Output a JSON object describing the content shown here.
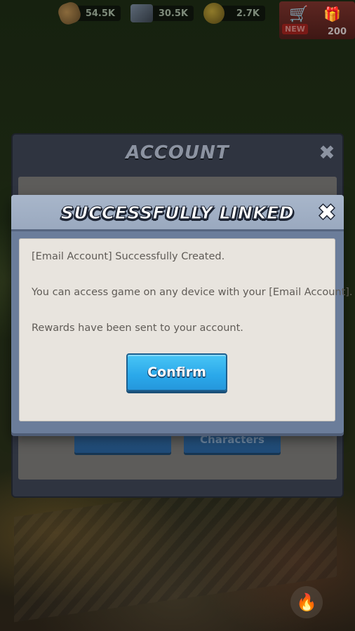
{
  "resources": {
    "wood": "54.5K",
    "iron": "30.5K",
    "gold": "2.7K"
  },
  "shop": {
    "badge": "NEW",
    "count": "200"
  },
  "account_panel": {
    "title": "ACCOUNT",
    "close_glyph": "✖",
    "left_button": "",
    "right_button": "Characters"
  },
  "dialog": {
    "title": "SUCCESSFULLY LINKED",
    "close_glyph": "✖",
    "messages": [
      "[Email Account] Successfully Created.",
      "You can access game on any device with your [Email Account].",
      "Rewards have been sent to your account."
    ],
    "confirm_label": "Confirm"
  },
  "colors": {
    "confirm_blue": "#2aa8ea",
    "dialog_frame": "#6b7d9a",
    "dialog_body": "#e8e4de"
  }
}
